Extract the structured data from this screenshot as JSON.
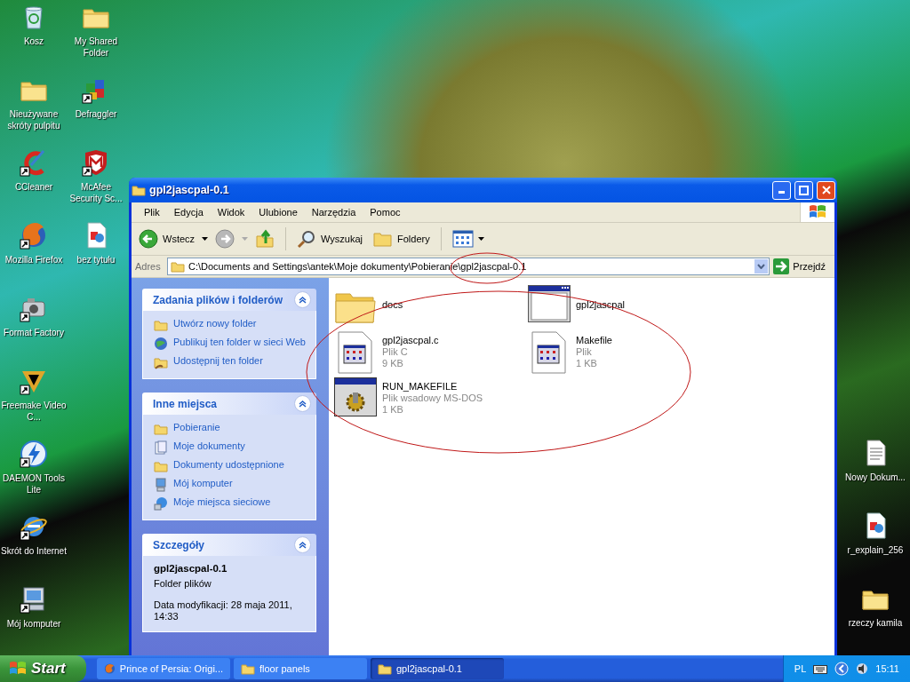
{
  "desktop_icons": [
    {
      "label": "Kosz",
      "kind": "recycle",
      "shortcut": false
    },
    {
      "label": "Nieużywane skróty pulpitu",
      "kind": "folder",
      "shortcut": false
    },
    {
      "label": "CCleaner",
      "kind": "brush",
      "shortcut": true
    },
    {
      "label": "Mozilla Firefox",
      "kind": "globe",
      "shortcut": true
    },
    {
      "label": "Format Factory",
      "kind": "camera",
      "shortcut": true
    },
    {
      "label": "Freemake Video C...",
      "kind": "vlogo",
      "shortcut": true
    },
    {
      "label": "DAEMON Tools Lite",
      "kind": "lightning",
      "shortcut": true
    },
    {
      "label": "Skrót do Internet",
      "kind": "ie",
      "shortcut": true
    },
    {
      "label": "Mój komputer",
      "kind": "computer",
      "shortcut": true
    },
    {
      "label": "My Shared Folder",
      "kind": "folder",
      "shortcut": false
    },
    {
      "label": "Defraggler",
      "kind": "cubes",
      "shortcut": true
    },
    {
      "label": "McAfee Security Sc...",
      "kind": "shield",
      "shortcut": true
    },
    {
      "label": "bez tytułu",
      "kind": "image",
      "shortcut": false
    }
  ],
  "desktop_icons_right": [
    {
      "label": "Nowy Dokum...",
      "kind": "text",
      "shortcut": false
    },
    {
      "label": "r_explain_256",
      "kind": "image",
      "shortcut": false
    },
    {
      "label": "rzeczy kamila",
      "kind": "folder",
      "shortcut": false
    }
  ],
  "window": {
    "title": "gpl2jascpal-0.1",
    "menu": [
      "Plik",
      "Edycja",
      "Widok",
      "Ulubione",
      "Narzędzia",
      "Pomoc"
    ],
    "toolbar": {
      "back": "Wstecz",
      "search": "Wyszukaj",
      "folders": "Foldery"
    },
    "address": {
      "label": "Adres",
      "value": "C:\\Documents and Settings\\antek\\Moje dokumenty\\Pobieranie\\gpl2jascpal-0.1",
      "go": "Przejdź"
    },
    "panels": [
      {
        "title": "Zadania plików i folderów",
        "kind": "links",
        "items": [
          {
            "label": "Utwórz nowy folder",
            "kind": "newfolder"
          },
          {
            "label": "Publikuj ten folder w sieci Web",
            "kind": "web"
          },
          {
            "label": "Udostępnij ten folder",
            "kind": "share"
          }
        ]
      },
      {
        "title": "Inne miejsca",
        "kind": "links",
        "items": [
          {
            "label": "Pobieranie",
            "kind": "folder"
          },
          {
            "label": "Moje dokumenty",
            "kind": "docs"
          },
          {
            "label": "Dokumenty udostępnione",
            "kind": "folder"
          },
          {
            "label": "Mój komputer",
            "kind": "computer"
          },
          {
            "label": "Moje miejsca sieciowe",
            "kind": "network"
          }
        ]
      },
      {
        "title": "Szczegóły",
        "kind": "details",
        "name": "gpl2jascpal-0.1",
        "type": "Folder plików",
        "modified": "Data modyfikacji: 28 maja 2011, 14:33"
      }
    ],
    "files": [
      {
        "name": "docs",
        "kind": "folder"
      },
      {
        "name": "gpl2jascpal",
        "kind": "window"
      },
      {
        "name": "gpl2jascpal.c",
        "type": "Plik C",
        "size": "9 KB",
        "kind": "document"
      },
      {
        "name": "Makefile",
        "type": "Plik",
        "size": "1 KB",
        "kind": "document"
      },
      {
        "name": "RUN_MAKEFILE",
        "type": "Plik wsadowy MS-DOS",
        "size": "1 KB",
        "kind": "batch"
      }
    ]
  },
  "taskbar": {
    "start": "Start",
    "tasks": [
      {
        "label": "Prince of Persia: Origi...",
        "kind": "browser",
        "selected": false
      },
      {
        "label": "floor panels",
        "kind": "folder",
        "selected": false
      },
      {
        "label": "gpl2jascpal-0.1",
        "kind": "folder",
        "selected": true
      }
    ],
    "language": "PL",
    "clock": "15:11"
  }
}
